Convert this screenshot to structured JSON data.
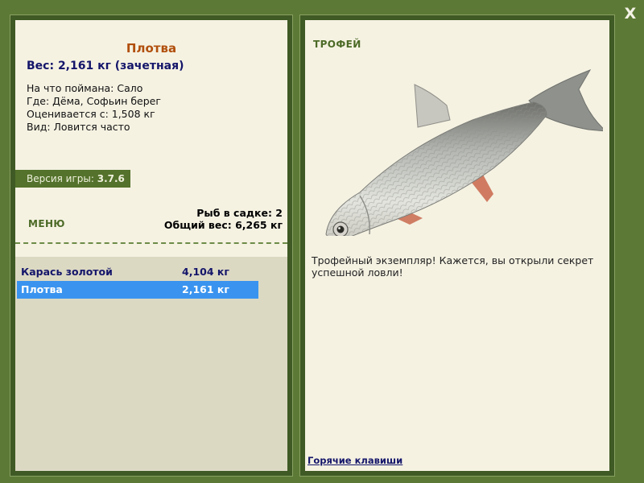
{
  "close_button": {
    "label": "X"
  },
  "fish": {
    "name": "Плотва",
    "weight_line": "Вес: 2,161 кг (зачетная)",
    "bait": "На что поймана: Сало",
    "location": "Где: Дёма, Софьин берег",
    "threshold": "Оценивается с: 1,508 кг",
    "species_note": "Вид: Ловится часто"
  },
  "version": {
    "label": "Версия игры:",
    "value": "3.7.6"
  },
  "menu_label": "МЕНЮ",
  "stats": {
    "count_line": "Рыб в садке: 2",
    "total_line": "Общий вес: 6,265 кг"
  },
  "catch_list": [
    {
      "name": "Карась золотой",
      "weight": "4,104 кг",
      "selected": false
    },
    {
      "name": "Плотва",
      "weight": "2,161 кг",
      "selected": true
    }
  ],
  "trophy": {
    "label": "ТРОФЕЙ",
    "description": "Трофейный экземпляр! Кажется, вы открыли секрет успешной ловли!"
  },
  "hotkeys_link": "Горячие клавиши",
  "colors": {
    "background": "#5c7a35",
    "panel": "#f5f2e2",
    "fish_name": "#b14f0c",
    "weight_text": "#14156a",
    "selection": "#3a94ef",
    "label_green": "#4c6a26"
  },
  "icons": {
    "close": "close-icon"
  }
}
